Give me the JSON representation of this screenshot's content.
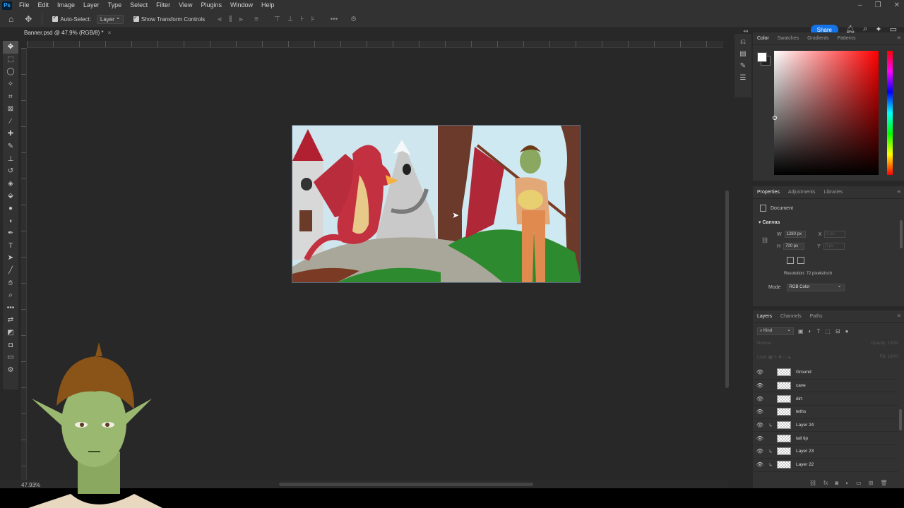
{
  "menubar": {
    "logo": "Ps",
    "items": [
      "File",
      "Edit",
      "Image",
      "Layer",
      "Type",
      "Select",
      "Filter",
      "View",
      "Plugins",
      "Window",
      "Help"
    ]
  },
  "options": {
    "auto_select_label": "Auto-Select:",
    "auto_select_target": "Layer",
    "transform_label": "Show Transform Controls",
    "more": "•••"
  },
  "share_label": "Share",
  "document": {
    "tab_title": "Banner.psd @ 47.9% (RGB/8) *",
    "close": "×",
    "zoom": "47.93%"
  },
  "color_panel": {
    "tabs": [
      "Color",
      "Swatches",
      "Gradients",
      "Patterns"
    ]
  },
  "properties": {
    "tabs": [
      "Properties",
      "Adjustments",
      "Libraries"
    ],
    "doc_label": "Document",
    "canvas_title": "Canvas",
    "w_label": "W",
    "w_value": "1280 px",
    "h_label": "H",
    "h_value": "700 px",
    "x_label": "X",
    "x_value": "0 px",
    "y_label": "Y",
    "y_value": "0 px",
    "resolution": "Resolution: 72 pixels/inch",
    "mode_label": "Mode",
    "mode_value": "RGB Color"
  },
  "layers": {
    "tabs": [
      "Layers",
      "Channels",
      "Paths"
    ],
    "kind": "Kind",
    "blend_mode": "Normal",
    "opacity_label": "Opacity:",
    "opacity_value": "100%",
    "lock_label": "Lock:",
    "fill_label": "Fill:",
    "fill_value": "100%",
    "items": [
      {
        "name": "Ground",
        "clipped": false
      },
      {
        "name": "cave",
        "clipped": false
      },
      {
        "name": "dirt",
        "clipped": false
      },
      {
        "name": "teths",
        "clipped": false
      },
      {
        "name": "Layer 24",
        "clipped": true
      },
      {
        "name": "tail tip",
        "clipped": false
      },
      {
        "name": "Layer 23",
        "clipped": true
      },
      {
        "name": "Layer 22",
        "clipped": true
      }
    ]
  },
  "colors": {
    "accent": "#1473e6",
    "panel": "#323232",
    "workspace": "#282828"
  }
}
